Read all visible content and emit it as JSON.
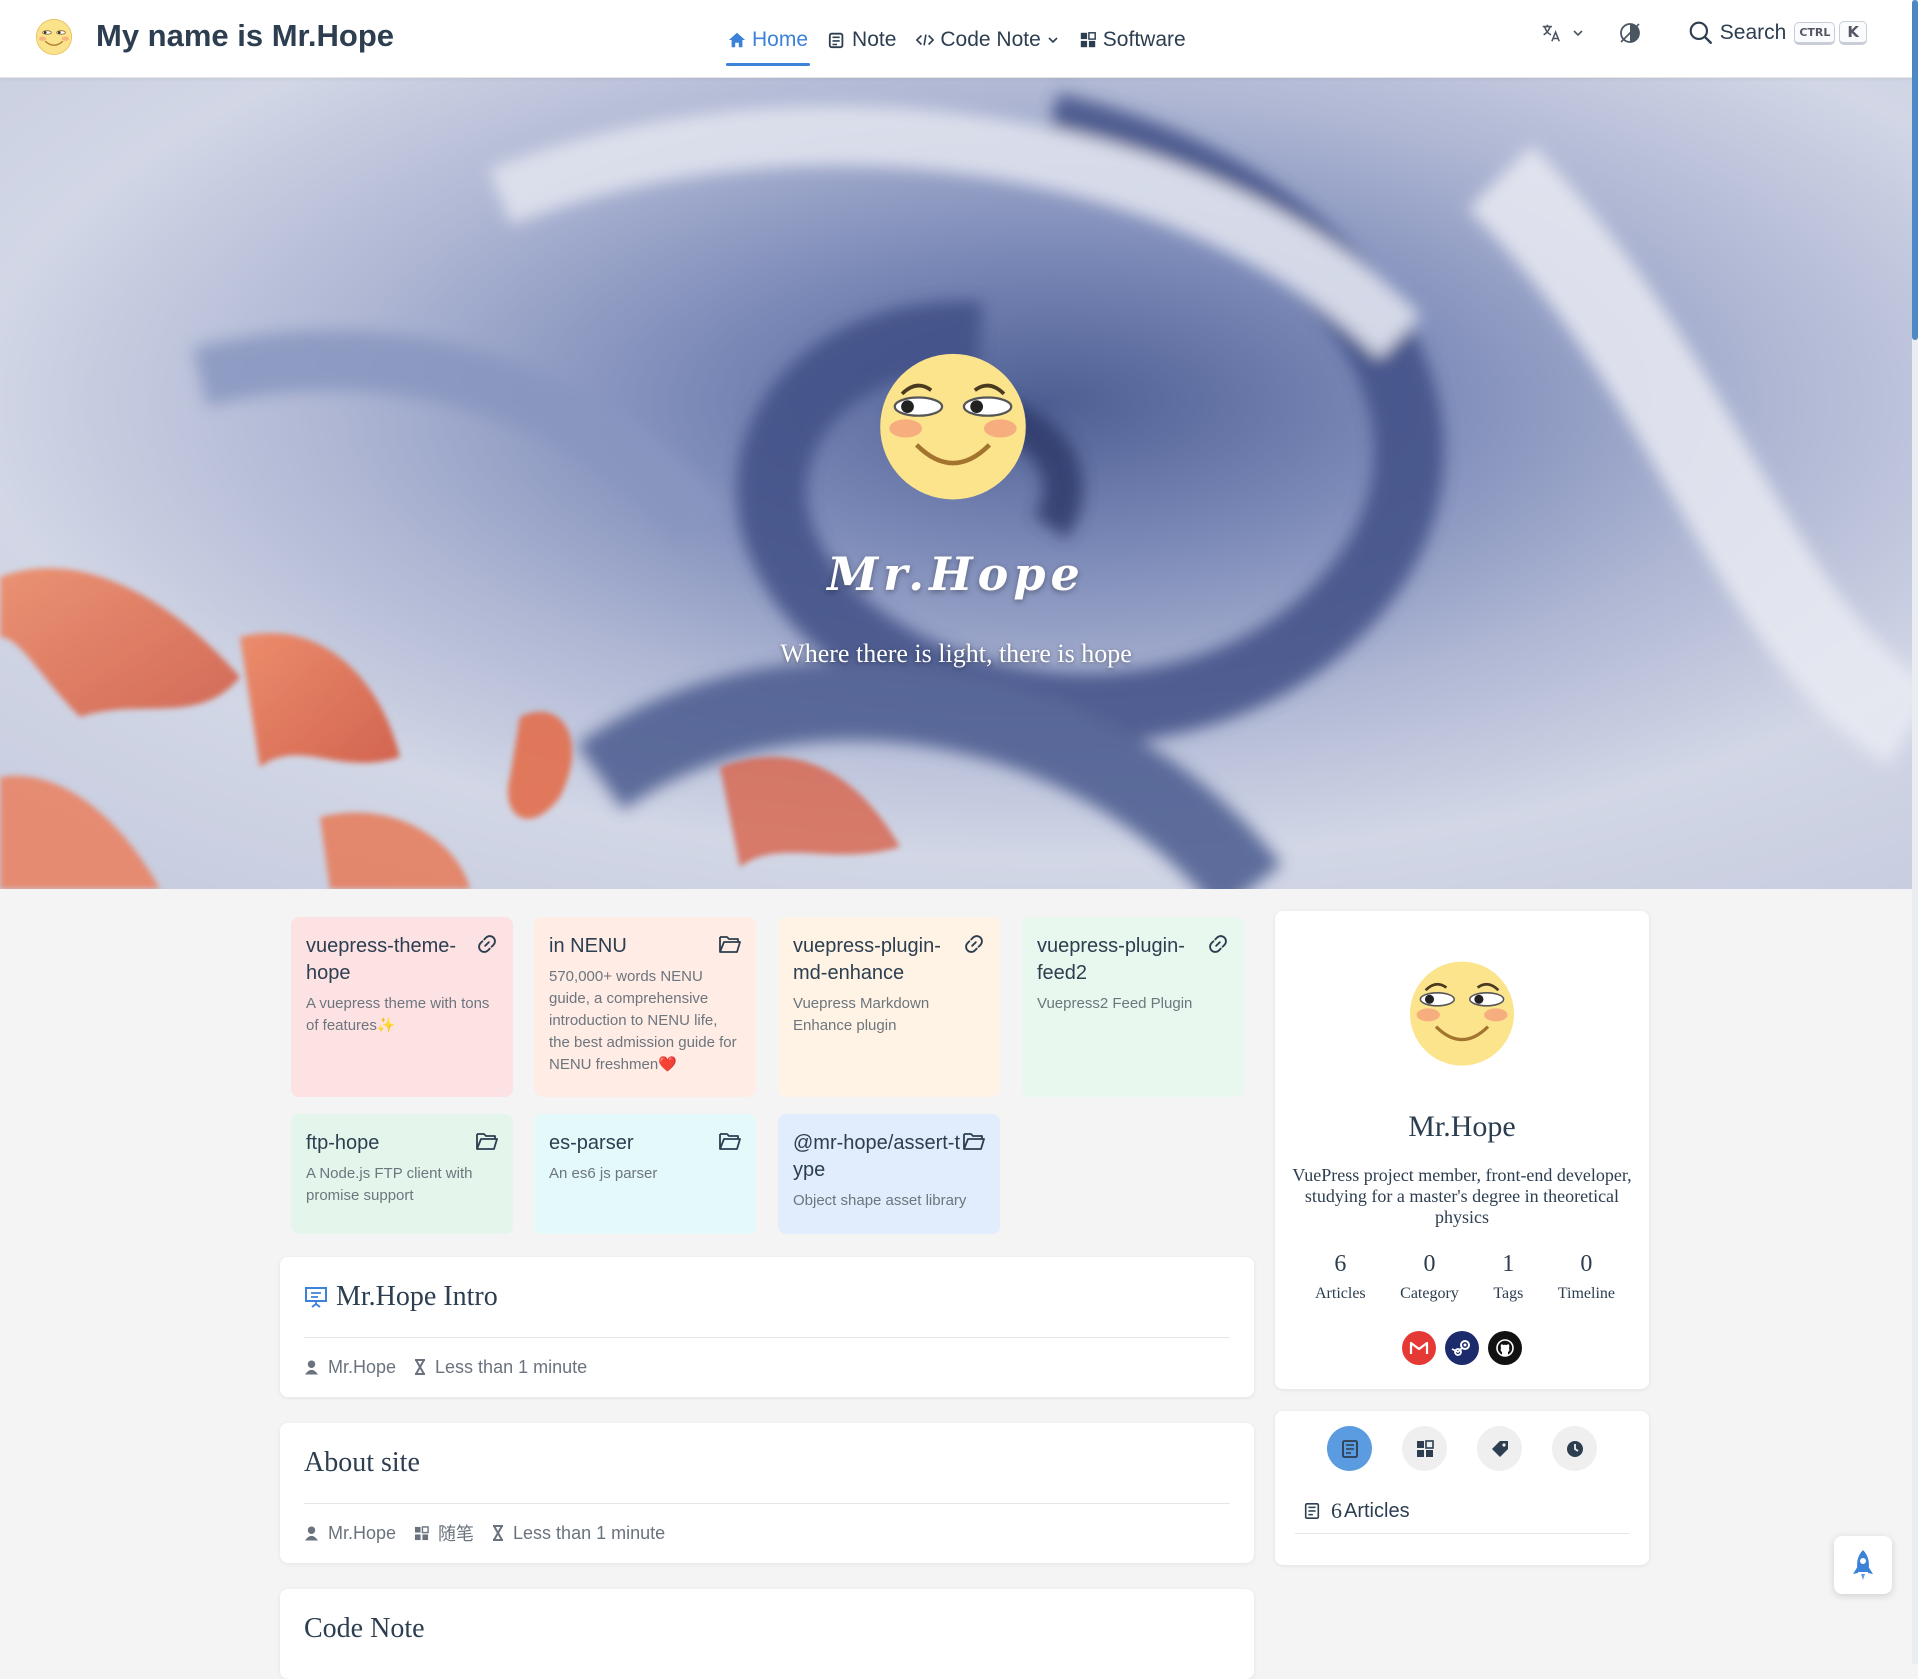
{
  "navbar": {
    "site_title": "My name is Mr.Hope",
    "links": [
      {
        "label": "Home",
        "icon": "home-icon",
        "active": true
      },
      {
        "label": "Note",
        "icon": "note-icon"
      },
      {
        "label": "Code Note",
        "icon": "code-icon",
        "dropdown": true
      },
      {
        "label": "Software",
        "icon": "software-icon"
      }
    ],
    "search_label": "Search",
    "search_key_ctrl": "CTRL",
    "search_key_k": "K"
  },
  "hero": {
    "title": "Mr.Hope",
    "subtitle": "Where there is light, there is hope"
  },
  "projects": [
    {
      "name": "vuepress-theme-hope",
      "desc": "A vuepress theme with tons of features✨",
      "icon": "link-icon",
      "color": "#fde2e4"
    },
    {
      "name": "in NENU",
      "desc": "570,000+ words NENU guide, a comprehensive introduction to NENU life, the best admission guide for NENU freshmen❤️",
      "icon": "folder-icon",
      "color": "#feece5"
    },
    {
      "name": "vuepress-plugin-md-enhance",
      "desc": "Vuepress Markdown Enhance plugin",
      "icon": "link-icon",
      "color": "#fef3e4"
    },
    {
      "name": "vuepress-plugin-feed2",
      "desc": "Vuepress2 Feed Plugin",
      "icon": "link-icon",
      "color": "#e8f8ee"
    },
    {
      "name": "ftp-hope",
      "desc": "A Node.js FTP client with promise support",
      "icon": "folder-icon",
      "color": "#e4f6ec"
    },
    {
      "name": "es-parser",
      "desc": "An es6 js parser",
      "icon": "folder-icon",
      "color": "#e3f9fa"
    },
    {
      "name": "@mr-hope/assert-type",
      "desc": "Object shape asset library",
      "icon": "folder-icon",
      "color": "#e1ecfc"
    }
  ],
  "articles": [
    {
      "title": "Mr.Hope Intro",
      "author": "Mr.Hope",
      "reading_time": "Less than 1 minute"
    },
    {
      "title": "About site",
      "author": "Mr.Hope",
      "category": "随笔",
      "reading_time": "Less than 1 minute"
    },
    {
      "title": "Code Note"
    }
  ],
  "blogger": {
    "name": "Mr.Hope",
    "description": "VuePress project member, front-end developer, studying for a master's degree in theoretical physics",
    "stats": [
      {
        "num": "6",
        "label": "Articles"
      },
      {
        "num": "0",
        "label": "Category"
      },
      {
        "num": "1",
        "label": "Tags"
      },
      {
        "num": "0",
        "label": "Timeline"
      }
    ],
    "socials": [
      {
        "name": "gmail-icon",
        "color": "#e53935"
      },
      {
        "name": "steam-icon",
        "color": "#1b2b6b"
      },
      {
        "name": "github-icon",
        "color": "#111111"
      }
    ]
  },
  "info": {
    "articles_count": "6",
    "articles_label": "Articles"
  },
  "colors": {
    "accent": "#3c82d8"
  }
}
